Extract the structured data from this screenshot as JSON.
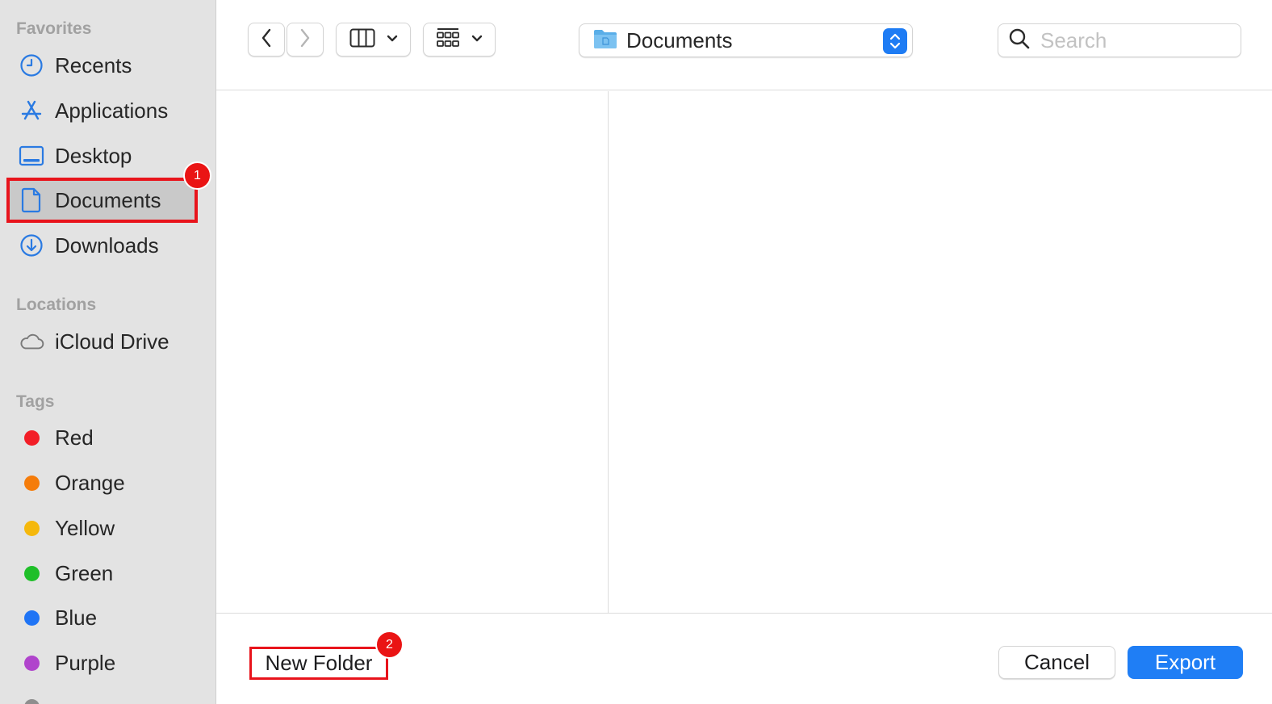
{
  "sidebar": {
    "favorites_header": "Favorites",
    "favorites": [
      {
        "label": "Recents",
        "icon": "clock-icon"
      },
      {
        "label": "Applications",
        "icon": "applications-icon"
      },
      {
        "label": "Desktop",
        "icon": "desktop-icon"
      },
      {
        "label": "Documents",
        "icon": "document-icon",
        "selected": true
      },
      {
        "label": "Downloads",
        "icon": "download-icon"
      }
    ],
    "locations_header": "Locations",
    "locations": [
      {
        "label": "iCloud Drive",
        "icon": "cloud-icon"
      }
    ],
    "tags_header": "Tags",
    "tags": [
      {
        "label": "Red",
        "color": "#f21e27"
      },
      {
        "label": "Orange",
        "color": "#f57c0a"
      },
      {
        "label": "Yellow",
        "color": "#f5b80c"
      },
      {
        "label": "Green",
        "color": "#1fbf29"
      },
      {
        "label": "Blue",
        "color": "#1f74f5"
      },
      {
        "label": "Purple",
        "color": "#b044cc"
      }
    ]
  },
  "toolbar": {
    "path_label": "Documents",
    "search_placeholder": "Search"
  },
  "footer": {
    "new_folder_label": "New Folder",
    "cancel_label": "Cancel",
    "export_label": "Export"
  },
  "annotations": {
    "badge_1": "1",
    "badge_2": "2"
  },
  "colors": {
    "accent": "#1f7ef5",
    "annotation_red": "#e8141c",
    "sidebar_icon_blue": "#2a7ae2"
  }
}
